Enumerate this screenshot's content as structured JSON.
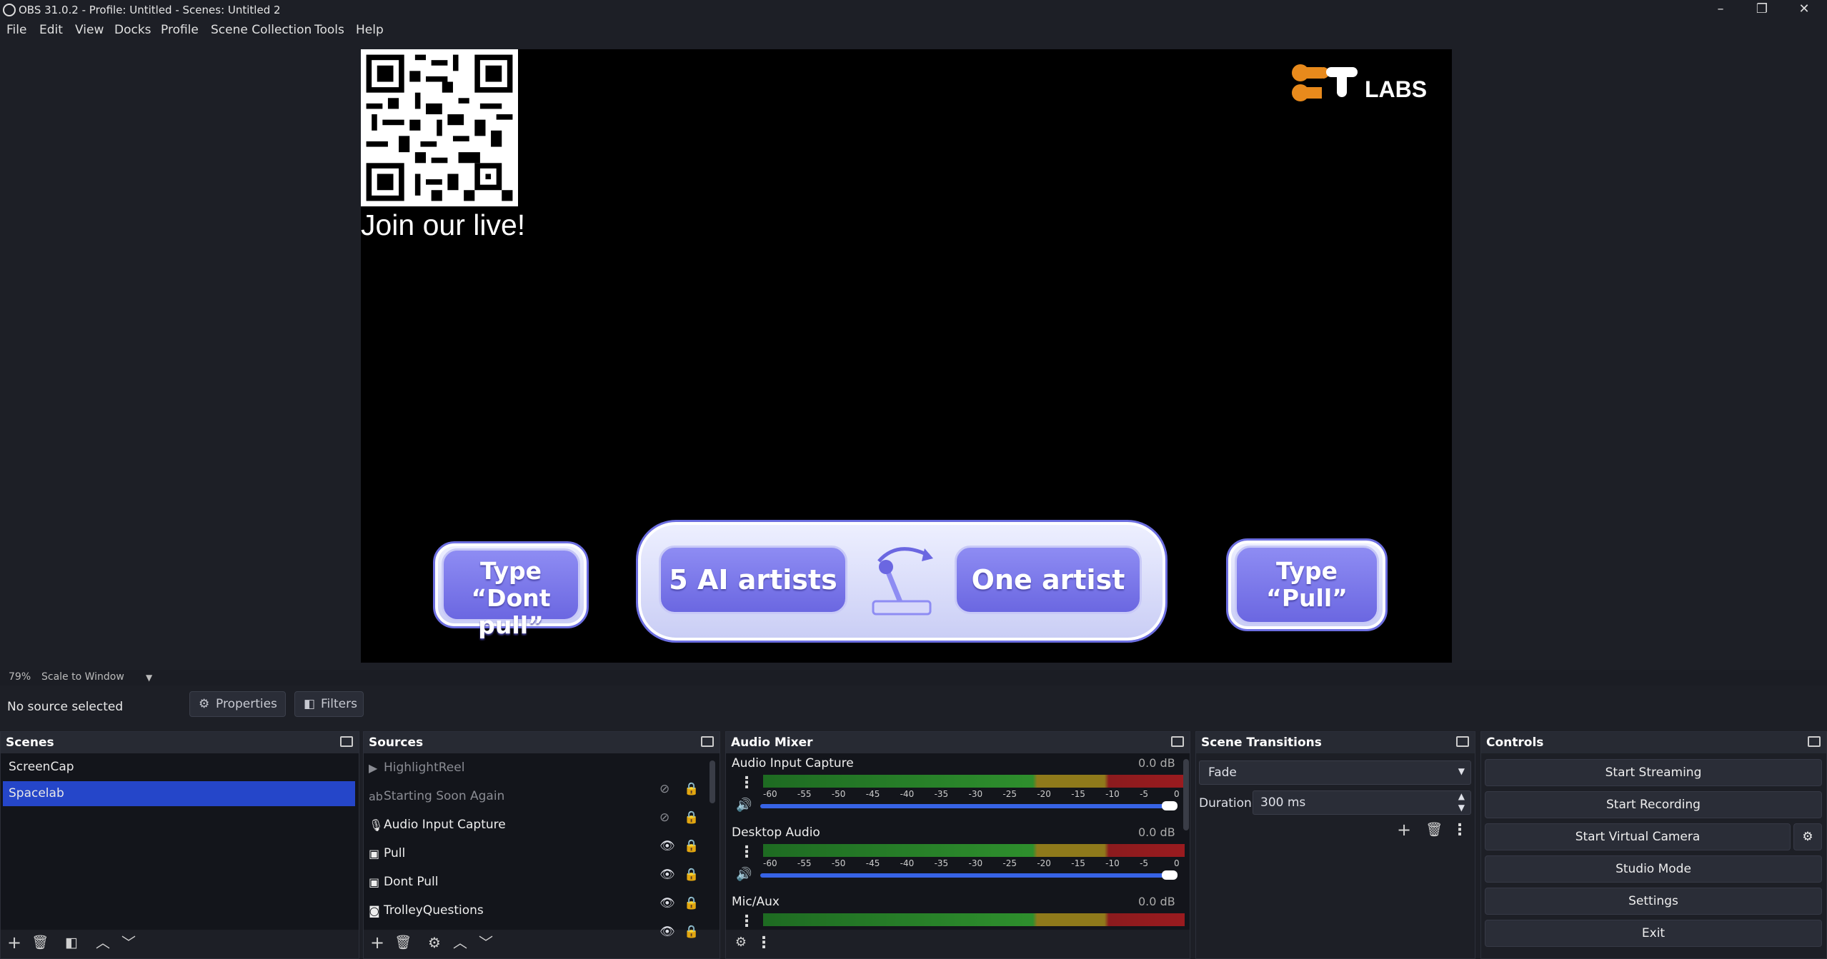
{
  "window": {
    "title": "OBS 31.0.2 - Profile: Untitled - Scenes: Untitled 2"
  },
  "menu": [
    "File",
    "Edit",
    "View",
    "Docks",
    "Profile",
    "Scene Collection",
    "Tools",
    "Help"
  ],
  "preview": {
    "qr_caption": "Join our live!",
    "logo_text": "LABS",
    "left_button": [
      "Type",
      "“Dont pull”"
    ],
    "center_left": "5 AI artists",
    "center_right": "One artist",
    "right_button": [
      "Type",
      "“Pull”"
    ]
  },
  "zoom": {
    "percent": "79%",
    "mode": "Scale to Window"
  },
  "context": {
    "status": "No source selected",
    "properties": "Properties",
    "filters": "Filters"
  },
  "scenes": {
    "title": "Scenes",
    "items": [
      "ScreenCap",
      "Spacelab"
    ],
    "selected": "Spacelab"
  },
  "sources": {
    "title": "Sources",
    "items": [
      {
        "name": "HighlightReel",
        "icon": "play-icon",
        "visible": false
      },
      {
        "name": "Starting Soon Again",
        "icon": "text-icon",
        "visible": false
      },
      {
        "name": "Audio Input Capture",
        "icon": "mic-icon",
        "visible": true
      },
      {
        "name": "Pull",
        "icon": "image-icon",
        "visible": true
      },
      {
        "name": "Dont Pull",
        "icon": "image-icon",
        "visible": true
      },
      {
        "name": "TrolleyQuestions",
        "icon": "browser-icon",
        "visible": true
      }
    ]
  },
  "mixer": {
    "title": "Audio Mixer",
    "ticks": [
      "-60",
      "-55",
      "-50",
      "-45",
      "-40",
      "-35",
      "-30",
      "-25",
      "-20",
      "-15",
      "-10",
      "-5",
      "0"
    ],
    "channels": [
      {
        "name": "Audio Input Capture",
        "db": "0.0 dB",
        "volume": 1.0
      },
      {
        "name": "Desktop Audio",
        "db": "0.0 dB",
        "volume": 1.0
      },
      {
        "name": "Mic/Aux",
        "db": "0.0 dB",
        "volume": 1.0
      }
    ]
  },
  "transitions": {
    "title": "Scene Transitions",
    "selected": "Fade",
    "duration_label": "Duration",
    "duration": "300 ms"
  },
  "controls": {
    "title": "Controls",
    "buttons": [
      "Start Streaming",
      "Start Recording",
      "Start Virtual Camera",
      "Studio Mode",
      "Settings",
      "Exit"
    ]
  },
  "colors": {
    "accent": "#2546c9",
    "background": "#1d1f26",
    "panel": "#13151b"
  }
}
